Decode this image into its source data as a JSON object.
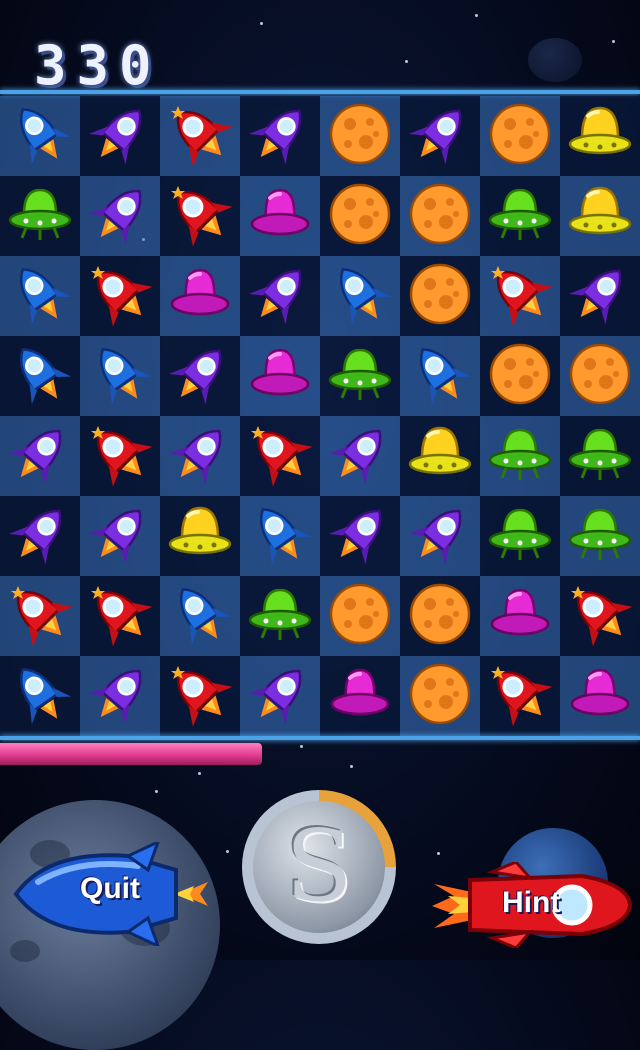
{
  "score": "330",
  "timer_fraction": 0.41,
  "board": [
    [
      "blue-rocket",
      "purple-rocket",
      "red-rocket",
      "purple-rocket",
      "orange-asteroid",
      "purple-rocket",
      "orange-asteroid",
      "yellow-ufo"
    ],
    [
      "green-ufo",
      "purple-rocket",
      "red-rocket",
      "pink-ufo",
      "orange-asteroid",
      "orange-asteroid",
      "green-ufo",
      "yellow-ufo"
    ],
    [
      "blue-rocket",
      "red-rocket",
      "pink-ufo",
      "purple-rocket",
      "blue-rocket",
      "orange-asteroid",
      "red-rocket",
      "purple-rocket"
    ],
    [
      "blue-rocket",
      "blue-rocket",
      "purple-rocket",
      "pink-ufo",
      "green-ufo",
      "blue-rocket",
      "orange-asteroid",
      "orange-asteroid"
    ],
    [
      "purple-rocket",
      "red-rocket",
      "purple-rocket",
      "red-rocket",
      "purple-rocket",
      "yellow-ufo",
      "green-ufo",
      "green-ufo"
    ],
    [
      "purple-rocket",
      "purple-rocket",
      "yellow-ufo",
      "blue-rocket",
      "purple-rocket",
      "purple-rocket",
      "green-ufo",
      "green-ufo"
    ],
    [
      "red-rocket",
      "red-rocket",
      "blue-rocket",
      "green-ufo",
      "orange-asteroid",
      "orange-asteroid",
      "pink-ufo",
      "red-rocket"
    ],
    [
      "blue-rocket",
      "purple-rocket",
      "red-rocket",
      "purple-rocket",
      "pink-ufo",
      "orange-asteroid",
      "red-rocket",
      "pink-ufo"
    ]
  ],
  "buttons": {
    "quit_label": "Quit",
    "hint_label": "Hint",
    "coin_symbol": "S"
  },
  "colors": {
    "rail": "#4aa3e8",
    "timer": "#e23d8f"
  }
}
